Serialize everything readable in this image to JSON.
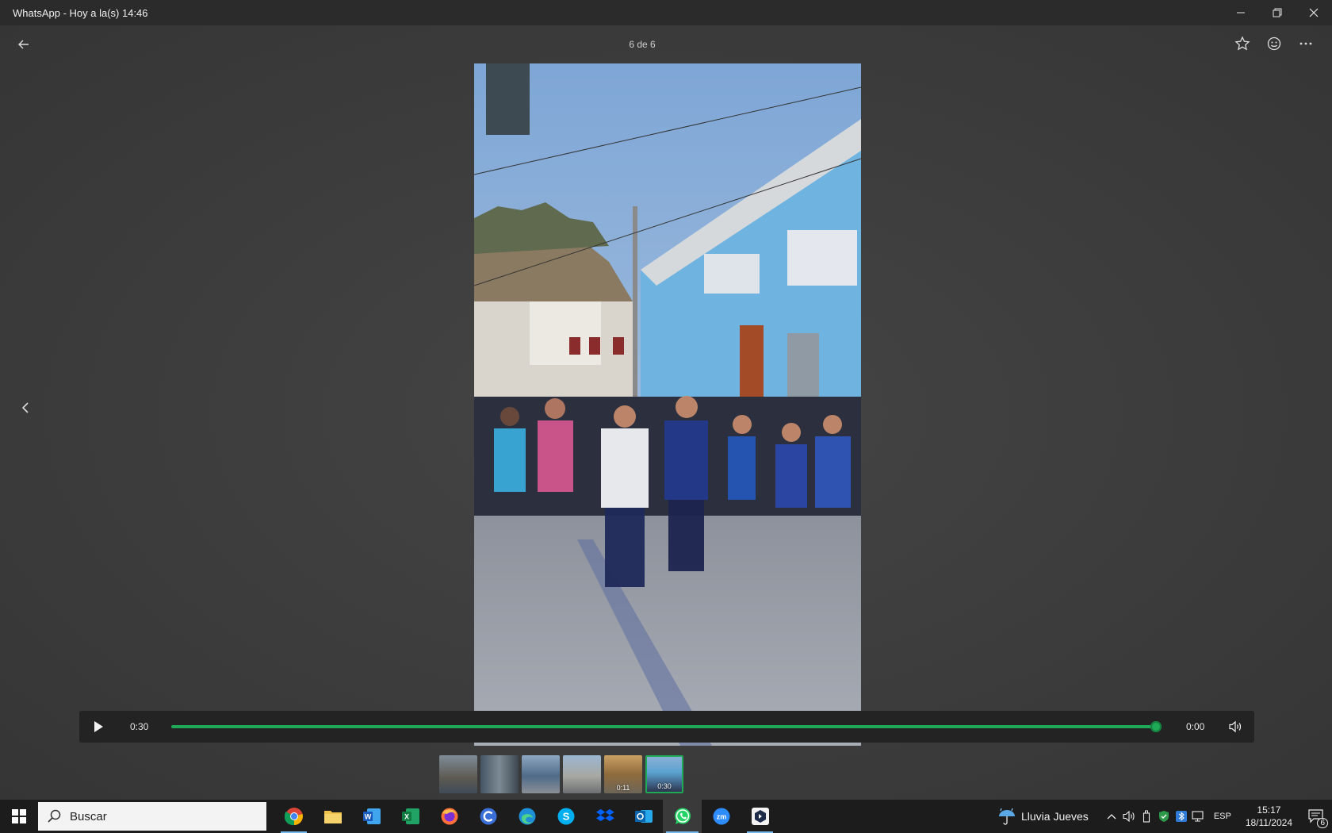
{
  "window": {
    "title": "WhatsApp - Hoy a la(s) 14:46"
  },
  "viewer": {
    "counter": "6 de 6"
  },
  "player": {
    "current_time": "0:30",
    "duration": "0:00",
    "progress": 1.0
  },
  "thumbnails": [
    {
      "label": ""
    },
    {
      "label": ""
    },
    {
      "label": ""
    },
    {
      "label": ""
    },
    {
      "label": "0:11"
    },
    {
      "label": "0:30",
      "selected": true
    }
  ],
  "taskbar": {
    "search_placeholder": "Buscar",
    "apps": [
      {
        "name": "chrome-icon"
      },
      {
        "name": "file-explorer-icon"
      },
      {
        "name": "word-icon"
      },
      {
        "name": "excel-icon"
      },
      {
        "name": "firefox-icon"
      },
      {
        "name": "ccleaner-icon"
      },
      {
        "name": "edge-icon"
      },
      {
        "name": "skype-icon"
      },
      {
        "name": "dropbox-icon"
      },
      {
        "name": "outlook-icon"
      },
      {
        "name": "whatsapp-icon"
      },
      {
        "name": "zoom-icon"
      },
      {
        "name": "app-icon"
      }
    ],
    "weather": "Lluvia Jueves",
    "language": "ESP",
    "time": "15:17",
    "date": "18/11/2024",
    "notifications": "6"
  },
  "colors": {
    "accent": "#1fa855",
    "taskbar": "#1c1c1c",
    "titlebar": "#2b2b2b"
  }
}
